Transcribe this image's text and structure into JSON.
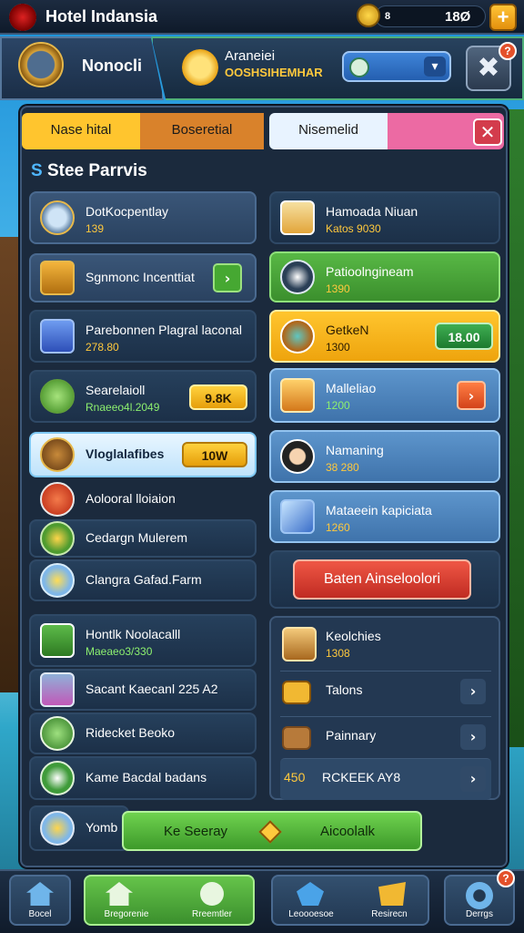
{
  "topbar": {
    "title": "Hotel Indansia",
    "currency_prefix": "8",
    "currency_value": "18Ø ",
    "add_label": "+"
  },
  "header": {
    "player_name": "Nonocli",
    "event_line1": "Araneiei",
    "event_line2": "OOSHSIHEMHAR",
    "dropdown_chevron": "▾",
    "close_label": "✖",
    "badge": "?"
  },
  "tabs": [
    {
      "label": "Nase hital",
      "color": "#ffc52e"
    },
    {
      "label": "Boseretial",
      "color": "#d9822b"
    },
    {
      "label": "Nisemelid",
      "color": "#e8f3ff"
    },
    {
      "label": "",
      "color": "#ec6aa3"
    }
  ],
  "tab_close": "✕",
  "section": {
    "prefix": "S",
    "title": "Stee Parrvis"
  },
  "left": [
    {
      "name": "DotKocpentlay",
      "sub": "139"
    },
    {
      "name": "Sgnmonc Incenttiat",
      "btn": "›"
    },
    {
      "name": "Parebonnen Plagral laconal",
      "sub": "278.80"
    },
    {
      "name": "Searelaioll",
      "sub": "Rnaeeo4l.2049",
      "btn": "9.8K"
    },
    {
      "name": "Vloglalafibes",
      "btn": "10W"
    },
    {
      "name": "Aolooral lloiaion"
    },
    {
      "name": "Cedargn Mulerem"
    },
    {
      "name": "Clangra Gafad.Farm"
    },
    {
      "name": "Hontlk Noolacalll",
      "sub": "Maeaeo3/330"
    },
    {
      "name": "Sacant Kaecanl 225 A2"
    },
    {
      "name": "Ridecket Beoko"
    },
    {
      "name": "Kame Bacdal badans"
    },
    {
      "name": "Yomb"
    }
  ],
  "right": [
    {
      "name": "Hamoada Niuan",
      "sub": "Katos 9030"
    },
    {
      "name": "Patioolngineam",
      "sub": "1390"
    },
    {
      "name": "GetkeN",
      "sub": "1300",
      "btn": "18.00"
    },
    {
      "name": "Malleliao",
      "sub": "1200",
      "btn": "›"
    },
    {
      "name": "Namaning",
      "sub": "38 280"
    },
    {
      "name": "Mataeein kapiciata",
      "sub": "1260"
    }
  ],
  "red_button": "Baten Ainseloolori",
  "list": [
    {
      "label": "Keolchies",
      "sub": "1308"
    },
    {
      "label": "Talons",
      "chev": "›"
    },
    {
      "label": "Painnary",
      "chev": "›"
    },
    {
      "label": "RCKEEK AY8",
      "prefix": "450",
      "chev": "›"
    }
  ],
  "green_bar": {
    "left": "Ke Seeray",
    "right": "Aicoolalk"
  },
  "nav": [
    {
      "label": "Bocel"
    },
    {
      "label": "Bregorenie",
      "label2": "Rreemtler"
    },
    {
      "label": "Leoooesoe",
      "label2": "Resirecn"
    },
    {
      "label": "Derrgs"
    }
  ],
  "nav_badge": "?",
  "colors": {
    "accent_gold": "#ffc93d",
    "panel": "#1b2a3d",
    "green": "#4caf3a"
  }
}
